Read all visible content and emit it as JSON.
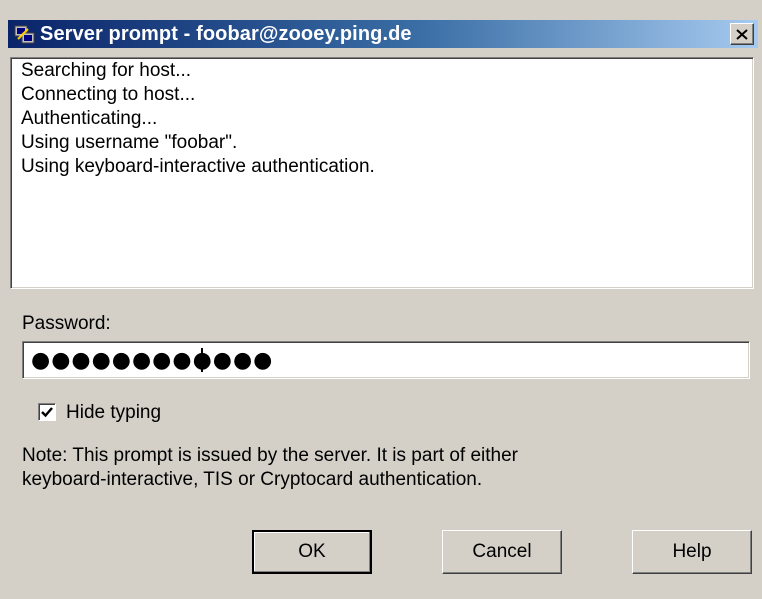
{
  "window": {
    "title": "Server prompt - foobar@zooey.ping.de",
    "close_icon": "close-icon",
    "app_icon": "putty-icon"
  },
  "log": {
    "lines": [
      "Searching for host...",
      "Connecting to host...",
      "Authenticating...",
      "Using username \"foobar\".",
      "Using keyboard-interactive authentication."
    ]
  },
  "password": {
    "label": "Password:",
    "masked_value": "●●●●●●●●●●●●"
  },
  "hide_typing": {
    "label": "Hide typing",
    "checked": true
  },
  "note": {
    "line1": "Note: This prompt is issued by the server. It is part of either",
    "line2": "keyboard-interactive, TIS or Cryptocard authentication."
  },
  "buttons": {
    "ok": "OK",
    "cancel": "Cancel",
    "help": "Help"
  }
}
